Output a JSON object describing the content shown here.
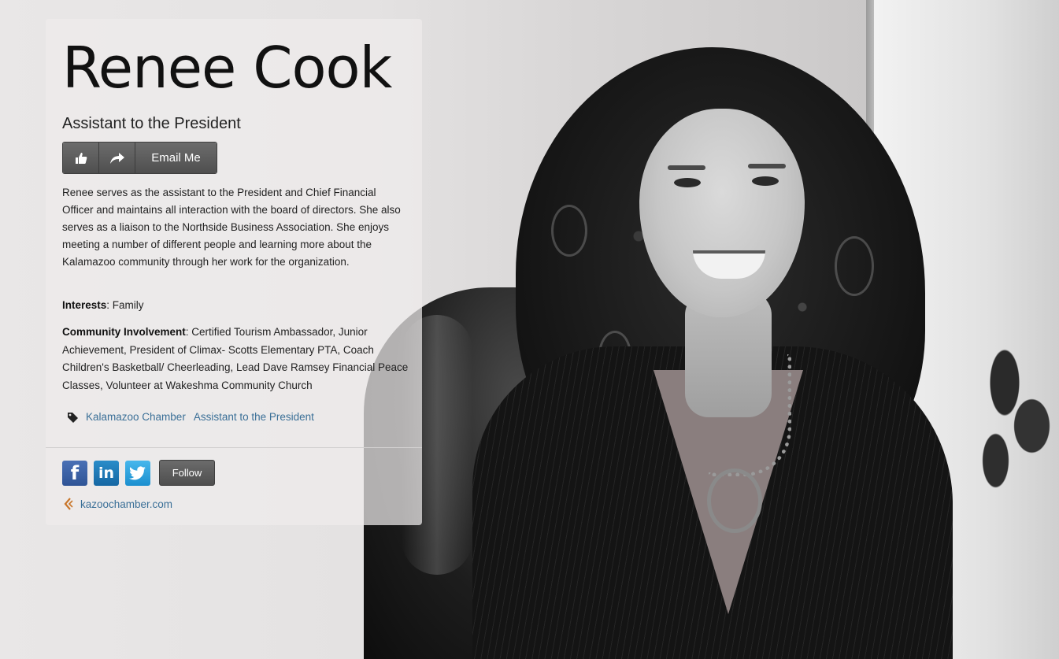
{
  "profile": {
    "name": "Renee Cook",
    "title": "Assistant to the President",
    "email_label": "Email Me",
    "bio": "Renee serves as the assistant to the President and Chief Financial Officer and maintains all interaction with the board of directors. She also serves as a liaison to the Northside Business Association. She enjoys meeting a number of different people and learning more about the Kalamazoo community through her work for the organization.",
    "interests_label": "Interests",
    "interests_value": ": Family",
    "community_label": "Community Involvement",
    "community_value": ": Certified Tourism Ambassador, Junior Achievement, President of Climax- Scotts Elementary PTA, Coach Children's Basketball/ Cheerleading, Lead Dave Ramsey Financial Peace Classes, Volunteer at Wakeshma Community Church"
  },
  "tags": [
    "Kalamazoo Chamber",
    "Assistant to the President"
  ],
  "social": {
    "facebook_icon": "facebook-icon",
    "linkedin_icon": "linkedin-icon",
    "twitter_icon": "twitter-icon",
    "follow_label": "Follow"
  },
  "website": {
    "label": "kazoochamber.com"
  },
  "colors": {
    "link": "#3a6f97",
    "button": "#5a5a5a"
  }
}
